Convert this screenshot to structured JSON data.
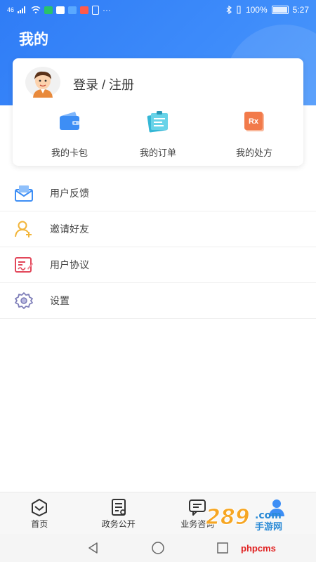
{
  "status_bar": {
    "network_label": "46",
    "more_label": "···",
    "battery_text": "100%",
    "time": "5:27"
  },
  "header": {
    "title": "我的"
  },
  "profile": {
    "avatar_icon": "user-avatar-icon",
    "login_label": "登录 / 注册"
  },
  "quick_actions": [
    {
      "label": "我的卡包",
      "icon": "wallet-icon",
      "color": "#3d8ef5"
    },
    {
      "label": "我的订单",
      "icon": "order-clipboard-icon",
      "color": "#35b7d6"
    },
    {
      "label": "我的处方",
      "icon": "prescription-rx-icon",
      "color": "#f27a4a"
    }
  ],
  "menu": [
    {
      "label": "用户反馈",
      "icon": "feedback-mail-icon",
      "color": "#3d8ef5"
    },
    {
      "label": "邀请好友",
      "icon": "invite-friend-icon",
      "color": "#f2b53a"
    },
    {
      "label": "用户协议",
      "icon": "agreement-doc-icon",
      "color": "#e2475a"
    },
    {
      "label": "设置",
      "icon": "gear-icon",
      "color": "#7d7db8"
    }
  ],
  "bottom_nav": [
    {
      "label": "首页",
      "icon": "home-icon"
    },
    {
      "label": "政务公开",
      "icon": "gov-doc-icon"
    },
    {
      "label": "业务咨询",
      "icon": "chat-icon"
    }
  ],
  "watermark": {
    "text": "289.com 手游网",
    "site": "phpcms"
  },
  "colors": {
    "primary": "#2f7cf6",
    "background": "#ffffff"
  }
}
